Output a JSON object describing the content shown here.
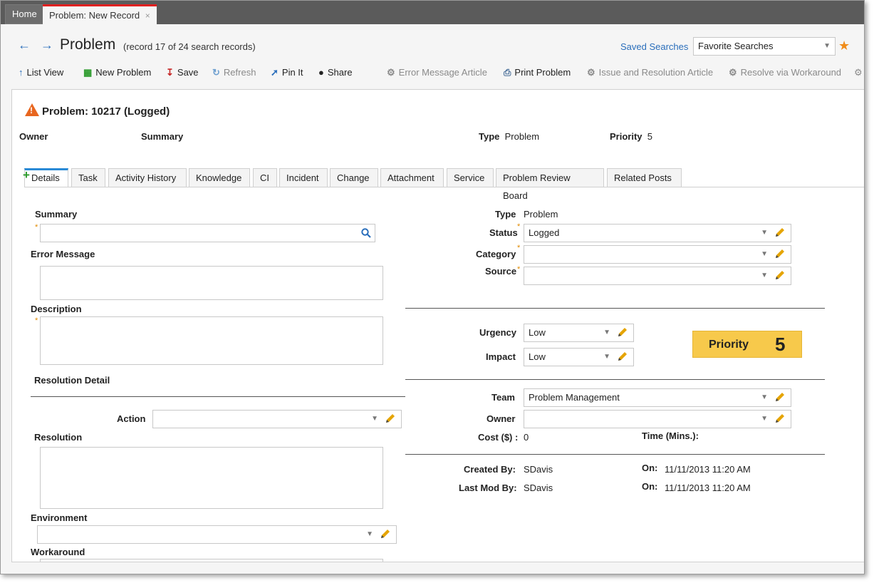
{
  "tabs": {
    "home": "Home",
    "active": "Problem: New Record",
    "close_glyph": "×"
  },
  "nav": {
    "back_glyph": "←",
    "forward_glyph": "→",
    "title": "Problem",
    "subtitle": "(record 17 of 24 search records)",
    "saved_searches": "Saved Searches",
    "favorite_searches": "Favorite Searches",
    "star_glyph": "★"
  },
  "toolbar": {
    "list_view": "List View",
    "new_problem": "New Problem",
    "save": "Save",
    "refresh": "Refresh",
    "pin_it": "Pin It",
    "share": "Share",
    "error_message_article": "Error Message Article",
    "print_problem": "Print Problem",
    "issue_resolution_article": "Issue and Resolution Article",
    "resolve_workaround": "Resolve via Workaround"
  },
  "record": {
    "title": "Problem: 10217 (Logged)",
    "owner_label": "Owner",
    "summary_label": "Summary",
    "type_label": "Type",
    "type_value": "Problem",
    "priority_label": "Priority",
    "priority_value": "5"
  },
  "form_tabs": [
    "Details",
    "Task",
    "Activity History",
    "Knowledge",
    "CI",
    "Incident",
    "Change",
    "Attachment",
    "Service",
    "Problem Review Board",
    "Related Posts"
  ],
  "left": {
    "summary": "Summary",
    "error_message": "Error Message",
    "description": "Description",
    "resolution_detail": "Resolution Detail",
    "action": "Action",
    "resolution": "Resolution",
    "environment": "Environment",
    "workaround": "Workaround"
  },
  "right": {
    "type_label": "Type",
    "type_value": "Problem",
    "status_label": "Status",
    "status_value": "Logged",
    "category_label": "Category",
    "source_label": "Source",
    "urgency_label": "Urgency",
    "urgency_value": "Low",
    "impact_label": "Impact",
    "impact_value": "Low",
    "priority_label": "Priority",
    "priority_value": "5",
    "team_label": "Team",
    "team_value": "Problem Management",
    "owner_label": "Owner",
    "cost_label": "Cost ($) :",
    "cost_value": "0",
    "time_label": "Time (Mins.):",
    "created_by_label": "Created By:",
    "created_by_value": "SDavis",
    "created_on_label": "On:",
    "created_on_value": "11/11/2013 11:20 AM",
    "lastmod_by_label": "Last Mod By:",
    "lastmod_by_value": "SDavis",
    "lastmod_on_label": "On:",
    "lastmod_on_value": "11/11/2013 11:20 AM"
  },
  "colors": {
    "accent": "#2a6ebb",
    "priority_bg": "#f7c94b",
    "required": "#e08a00",
    "active_tab_top": "#e02020"
  }
}
